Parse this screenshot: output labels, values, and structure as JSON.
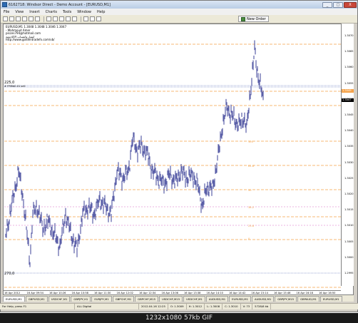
{
  "window": {
    "title": "6162718: Windsor Direct - Demo Account - [EURUSD,M1]",
    "min_label": "_",
    "max_label": "□",
    "close_label": "X"
  },
  "menu": [
    "File",
    "View",
    "Insert",
    "Charts",
    "Tools",
    "Window",
    "Help"
  ],
  "toolbar": {
    "new_order": "New Order"
  },
  "chart": {
    "header": [
      "EURUSD,M1 1.3048 1.3048 1.3046 1.3047",
      "- Mahmoud Amer",
      "pisces794@hotmail.com",
      "ايميل وانتساب الاكاديمية",
      "http://www.goldentradefx.com/vb/"
    ],
    "level_high": "225,0",
    "level_low": "270,0",
    "indicator_label": "# FRMA0.01 sell",
    "price_ticks": [
      "1.3070",
      "1.3065",
      "1.3060",
      "1.3055",
      "1.3050",
      "1.3045",
      "1.3040",
      "1.3035",
      "1.3030",
      "1.3025",
      "1.3020",
      "1.3015",
      "1.3010",
      "1.3005",
      "1.3000",
      "1.2995"
    ],
    "current_price": "1.3047",
    "tag_orange": "1.3049",
    "fib_labels": [
      "100",
      "61.8",
      "50",
      "38.2",
      "23.6",
      "0"
    ],
    "time_ticks": [
      "16 Apr 2012",
      "16 Apr 09:54",
      "16 Apr 10:26",
      "16 Apr 10:58",
      "16 Apr 11:30",
      "16 Apr 12:02",
      "16 Apr 12:34",
      "16 Apr 13:06",
      "16 Apr 13:38",
      "16 Apr 14:10",
      "16 Apr 14:42",
      "16 Apr 15:14",
      "16 Apr 15:46",
      "16 Apr 16:18",
      "16 Apr 16:50"
    ],
    "colors": {
      "candles": "#5b5fa8",
      "fib_orange": "#f5a34a",
      "fib_pink": "#e59bd9",
      "dotted_blue": "#7f8fc9"
    }
  },
  "tabs": [
    "EURUSD,M1",
    "GBPUSD,M1",
    "USDCHF,M1",
    "GBPJPY,H1",
    "EURJPY,M1",
    "GBPCHF,M1",
    "GBPCHF,M15",
    "USDCHF,M15",
    "USDCHF,M1",
    "AUDUSD,M1",
    "EURUSD,M1",
    "AUDUSD,M1",
    "GBPJPY,M15",
    "GBPAUD,M1",
    "EURUSD,M1"
  ],
  "status": {
    "help": "For Help, press F1",
    "profile": "ALL Digital",
    "datetime": "2012.04.16 12:25",
    "open": "O: 1.3009",
    "high": "H: 1.3012",
    "low": "L: 1.3008",
    "close": "C: 1.3010",
    "volume": "V: 73",
    "traffic": "5728/6 kb"
  },
  "caption": "1232x1080  57kb  GIF"
}
